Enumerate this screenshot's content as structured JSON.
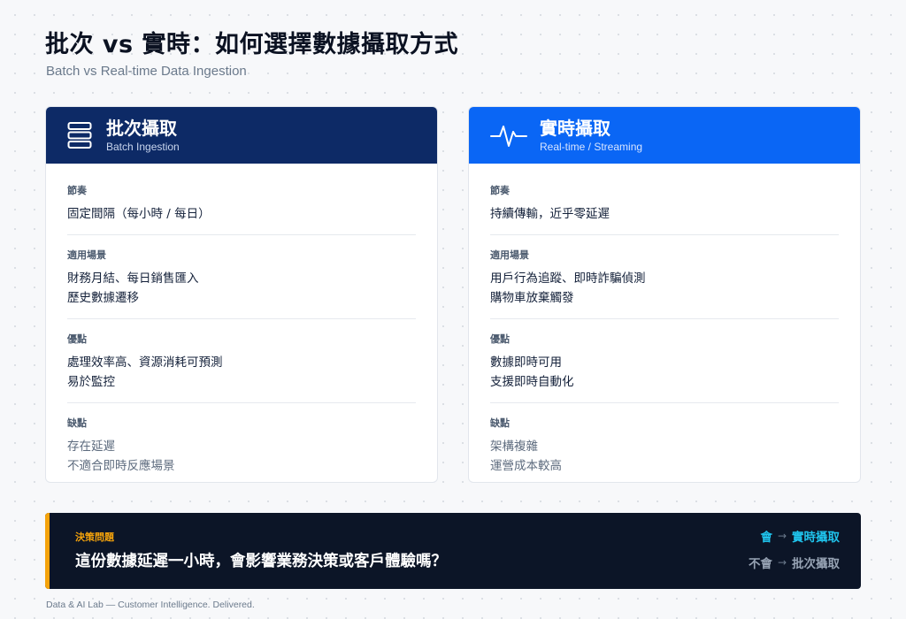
{
  "header": {
    "title": "批次 vs 實時：如何選擇數據攝取方式",
    "subtitle": "Batch vs Real-time Data Ingestion"
  },
  "batch": {
    "icon": "server-stack-icon",
    "title": "批次攝取",
    "subtitle": "Batch Ingestion",
    "accent": "#0d2a66",
    "sections": [
      {
        "label": "節奏",
        "lines": [
          "固定間隔（每小時 / 每日）"
        ]
      },
      {
        "label": "適用場景",
        "lines": [
          "財務月結、每日銷售匯入",
          "歷史數據遷移"
        ]
      },
      {
        "label": "優點",
        "lines": [
          "處理效率高、資源消耗可預測",
          "易於監控"
        ]
      },
      {
        "label": "缺點",
        "lines": [
          "存在延遲",
          "不適合即時反應場景"
        ]
      }
    ]
  },
  "stream": {
    "icon": "pulse-wave-icon",
    "title": "實時攝取",
    "subtitle": "Real-time / Streaming",
    "accent": "#0a66f5",
    "sections": [
      {
        "label": "節奏",
        "lines": [
          "持續傳輸，近乎零延遲"
        ]
      },
      {
        "label": "適用場景",
        "lines": [
          "用戶行為追蹤、即時詐騙偵測",
          "購物車放棄觸發"
        ]
      },
      {
        "label": "優點",
        "lines": [
          "數據即時可用",
          "支援即時自動化"
        ]
      },
      {
        "label": "缺點",
        "lines": [
          "架構複雜",
          "運營成本較高"
        ]
      }
    ]
  },
  "decision": {
    "label": "決策問題",
    "question": "這份數據延遲一小時，會影響業務決策或客戶體驗嗎？",
    "yes": {
      "condition": "會",
      "arrow": "→",
      "result": "實時攝取"
    },
    "no": {
      "condition": "不會",
      "arrow": "→",
      "result": "批次攝取"
    },
    "accent": "#f5a30b"
  },
  "footer": "Data & AI Lab — Customer Intelligence. Delivered."
}
